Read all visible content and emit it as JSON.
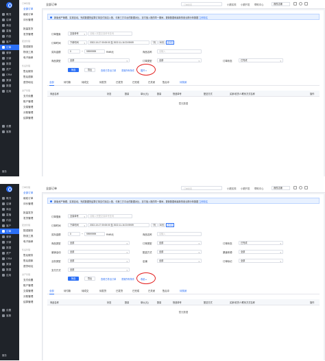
{
  "sidebar": {
    "items": [
      {
        "label": "概况",
        "icon": "overview-icon"
      },
      {
        "label": "店铺",
        "icon": "store-icon"
      },
      {
        "label": "商品",
        "icon": "goods-icon"
      },
      {
        "label": "直播",
        "icon": "live-icon"
      },
      {
        "label": "内容",
        "icon": "content-icon"
      },
      {
        "label": "客户",
        "icon": "customer-icon"
      },
      {
        "label": "订单",
        "icon": "order-icon",
        "active": true
      },
      {
        "label": "营销",
        "icon": "marketing-icon"
      },
      {
        "label": "分销",
        "icon": "distribution-icon"
      },
      {
        "label": "数据",
        "icon": "data-icon"
      },
      {
        "label": "资产",
        "icon": "assets-icon"
      },
      {
        "label": "CRM",
        "icon": "crm-icon"
      },
      {
        "label": "渠道",
        "icon": "channel-icon"
      },
      {
        "label": "数据",
        "icon": "data2-icon"
      },
      {
        "label": "应用",
        "icon": "apps-icon"
      },
      {
        "label": "设置",
        "icon": "settings-icon"
      },
      {
        "label": "客服",
        "icon": "service-icon"
      }
    ],
    "bottom": "服务"
  },
  "submenu": {
    "groups": [
      {
        "title": "订单管理",
        "items": [
          "全部订单",
          "维权订单",
          "评价管理"
        ]
      },
      {
        "title": "",
        "items": [
          "批量发货",
          "发货管理"
        ]
      },
      {
        "title": "配送管理",
        "items": [
          "配送服务",
          "物流工具",
          "电子面单"
        ]
      },
      {
        "title": "售后管理",
        "items": [
          "售后服务",
          "售后退款",
          "退货地址"
        ]
      },
      {
        "title": "资产管理",
        "items": [
          "支付设置",
          "账户管理",
          "交易管理",
          "分账管理",
          "结算管理"
        ]
      }
    ]
  },
  "header": {
    "title": "全部订单",
    "search_placeholder": "订单搜索",
    "links": [
      "小额实现",
      "小额开发",
      "帮助中心"
    ],
    "store": "我的店铺"
  },
  "notice": {
    "text": "新版资产管理、实现自动。完成数据的结算订单支付到店入账，与第三方平台的数据对比，支付宝入账的同一期间，更新数据和最新的营业额分析数据",
    "link": "立即前往"
  },
  "filters": {
    "order_search_label": "订单搜索",
    "order_search_type": "交易单号",
    "order_search_placeholder": "请输入完整交易单号查询",
    "order_time_label": "订单时间",
    "order_time_type": "下单时间",
    "date_start": "2022-10-17 00:00:00",
    "date_to": "至",
    "date_end": "2022-11-16 23:59:59",
    "quick": [
      "7天",
      "30天",
      "近3月"
    ],
    "amount_label": "实际金额",
    "amount_min": "0",
    "amount_max": "99999999",
    "amount_unit": "RMB元",
    "goods_type_label": "商品类型",
    "goods_type_value": "全部",
    "goods_name_label": "商品名称",
    "goods_name_placeholder": "请输入",
    "order_type_label": "订单类型",
    "order_type_value": "全部",
    "order_status_label": "订单状态",
    "order_status_value": "已完成",
    "promo_label": "营销活动",
    "promo_value": "全部",
    "delivery_label": "配送方式",
    "delivery_value": "全部",
    "channel_label": "渠道来源",
    "channel_value": "全部",
    "biz_label": "业务类型",
    "biz_value": "全部",
    "pay_label": "支付方式",
    "pay_value": "全部",
    "tag_label": "订单标记",
    "tag_value": "全部",
    "shop_label": "店铺",
    "shop_value": "全部"
  },
  "actions": {
    "filter": "筛选",
    "export": "导出",
    "view_exported": "查看已导出订单",
    "reset": "重置所有条件",
    "expand": "展开",
    "collapse": "收起"
  },
  "tabs": [
    "全部",
    "待付款",
    "待成交",
    "待发货",
    "已发货",
    "已完成",
    "已关闭",
    "售后中",
    "待核销"
  ],
  "table": {
    "columns": [
      "商品名称",
      "状态",
      "数量",
      "单价(元)",
      "数量",
      "快递单号",
      "配送方式",
      "买家/收货人/联系方式名称",
      "操作"
    ],
    "empty": "暂无数据"
  },
  "colors": {
    "accent": "#2b6ff5",
    "annotation": "#e21b1b",
    "sidebar": "#1f2329"
  }
}
